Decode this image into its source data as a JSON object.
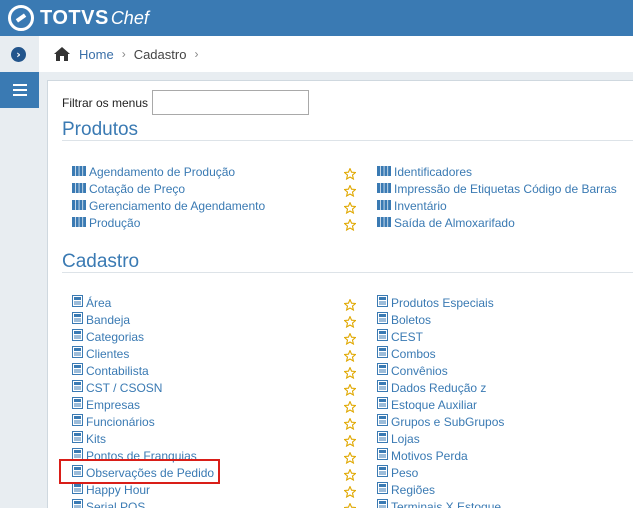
{
  "header": {
    "brand_bold": "TOTVS",
    "brand_light": "Chef"
  },
  "breadcrumb": {
    "home": "Home",
    "current": "Cadastro",
    "sep": "›"
  },
  "filter": {
    "label": "Filtrar os menus",
    "value": ""
  },
  "sections": [
    {
      "title": "Produtos",
      "icon": "columns-icon",
      "left": [
        "Agendamento de Produção",
        "Cotação de Preço",
        "Gerenciamento de Agendamento",
        "Produção"
      ],
      "right": [
        "Identificadores",
        "Impressão de Etiquetas Código de Barras",
        "Inventário",
        "Saída de Almoxarifado"
      ]
    },
    {
      "title": "Cadastro",
      "icon": "form-icon",
      "left": [
        "Área",
        "Bandeja",
        "Categorias",
        "Clientes",
        "Contabilista",
        "CST / CSOSN",
        "Empresas",
        "Funcionários",
        "Kits",
        "Pontos de Franquias",
        "Observações de Pedido",
        "Happy Hour",
        "Serial POS"
      ],
      "right": [
        "Produtos Especiais",
        "Boletos",
        "CEST",
        "Combos",
        "Convênios",
        "Dados Redução z",
        "Estoque Auxiliar",
        "Grupos e SubGrupos",
        "Lojas",
        "Motivos Perda",
        "Peso",
        "Regiões",
        "Terminais X Estoque"
      ]
    }
  ],
  "colors": {
    "accent": "#3a7ab3",
    "star": "#e0a800",
    "highlight": "#d91e18"
  }
}
